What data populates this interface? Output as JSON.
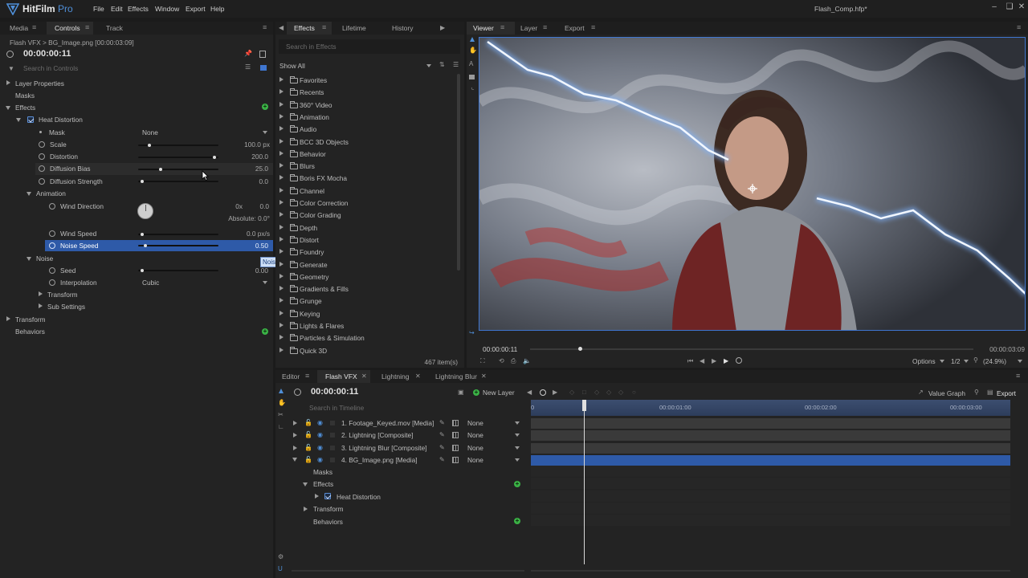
{
  "app": {
    "name": "HitFilm",
    "edition": "Pro",
    "window_title": "Flash_Comp.hfp*"
  },
  "menu": [
    "File",
    "Edit",
    "Effects",
    "Window",
    "Export",
    "Help"
  ],
  "left_panel": {
    "tabs": [
      "Media",
      "Controls",
      "Track"
    ],
    "breadcrumb": "Flash VFX > BG_Image.png [00:00:03:09]",
    "time": "00:00:00:11",
    "search_placeholder": "Search in Controls",
    "rows": {
      "layer_properties": "Layer Properties",
      "masks": "Masks",
      "effects": "Effects",
      "heat_distortion": "Heat Distortion",
      "mask_label": "Mask",
      "mask_value": "None",
      "scale_label": "Scale",
      "scale_value": "100.0 px",
      "distortion_label": "Distortion",
      "distortion_value": "200.0",
      "diffusion_bias_label": "Diffusion Bias",
      "diffusion_bias_value": "25.0",
      "diffusion_strength_label": "Diffusion Strength",
      "diffusion_strength_value": "0.0",
      "animation_label": "Animation",
      "wind_direction_label": "Wind Direction",
      "wind_direction_turns": "0x",
      "wind_direction_value": "0.0",
      "wind_direction_absolute": "Absolute: 0.0°",
      "wind_speed_label": "Wind Speed",
      "wind_speed_value": "0.0 px/s",
      "noise_speed_label": "Noise Speed",
      "noise_speed_value": "0.50",
      "noise_speed_tooltip": "Noise Speed",
      "noise_label": "Noise",
      "seed_label": "Seed",
      "seed_value": "0.00",
      "interpolation_label": "Interpolation",
      "interpolation_value": "Cubic",
      "transform_sub": "Transform",
      "sub_settings": "Sub Settings",
      "transform": "Transform",
      "behaviors": "Behaviors"
    },
    "slider_levels": {
      "scale": 0.12,
      "distortion": 0.97,
      "diffusion_bias": 0.27,
      "diffusion_strength": 0.03,
      "wind_speed": 0.03,
      "noise_speed": 0.07,
      "seed": 0.03
    }
  },
  "effects_panel": {
    "tabs": [
      "Effects",
      "Lifetime",
      "History"
    ],
    "search_placeholder": "Search in Effects",
    "filter": "Show All",
    "folders": [
      "Favorites",
      "Recents",
      "360° Video",
      "Animation",
      "Audio",
      "BCC 3D Objects",
      "Behavior",
      "Blurs",
      "Boris FX Mocha",
      "Channel",
      "Color Correction",
      "Color Grading",
      "Depth",
      "Distort",
      "Foundry",
      "Generate",
      "Geometry",
      "Gradients & Fills",
      "Grunge",
      "Keying",
      "Lights & Flares",
      "Particles & Simulation",
      "Quick 3D"
    ],
    "item_count": "467 item(s)"
  },
  "viewer": {
    "tabs": [
      "Viewer",
      "Layer",
      "Export"
    ],
    "time_current": "00:00:00:11",
    "time_end": "00:00:03:09",
    "options_label": "Options",
    "resolution": "1/2",
    "zoom": "(24.9%)"
  },
  "editor": {
    "tabs": [
      "Editor",
      "Flash VFX",
      "Lightning",
      "Lightning Blur"
    ],
    "time": "00:00:00:11",
    "new_layer": "New Layer",
    "value_graph": "Value Graph",
    "export": "Export",
    "search_placeholder": "Search in Timeline",
    "ruler": [
      "00:00:01:00",
      "00:00:02:00",
      "00:00:03:00"
    ],
    "layers": [
      {
        "name": "1. Footage_Keyed.mov [Media]",
        "blend": "None"
      },
      {
        "name": "2. Lightning [Composite]",
        "blend": "None"
      },
      {
        "name": "3. Lightning Blur [Composite]",
        "blend": "None"
      },
      {
        "name": "4. BG_Image.png [Media]",
        "blend": "None"
      }
    ],
    "sub_rows": {
      "masks": "Masks",
      "effects": "Effects",
      "heat_distortion": "Heat Distortion",
      "transform": "Transform",
      "behaviors": "Behaviors"
    },
    "playhead_fraction": 0.11
  },
  "colors": {
    "accent": "#3f76d0",
    "selected_row": "#2e5aa8",
    "add_green": "#3bb346"
  }
}
